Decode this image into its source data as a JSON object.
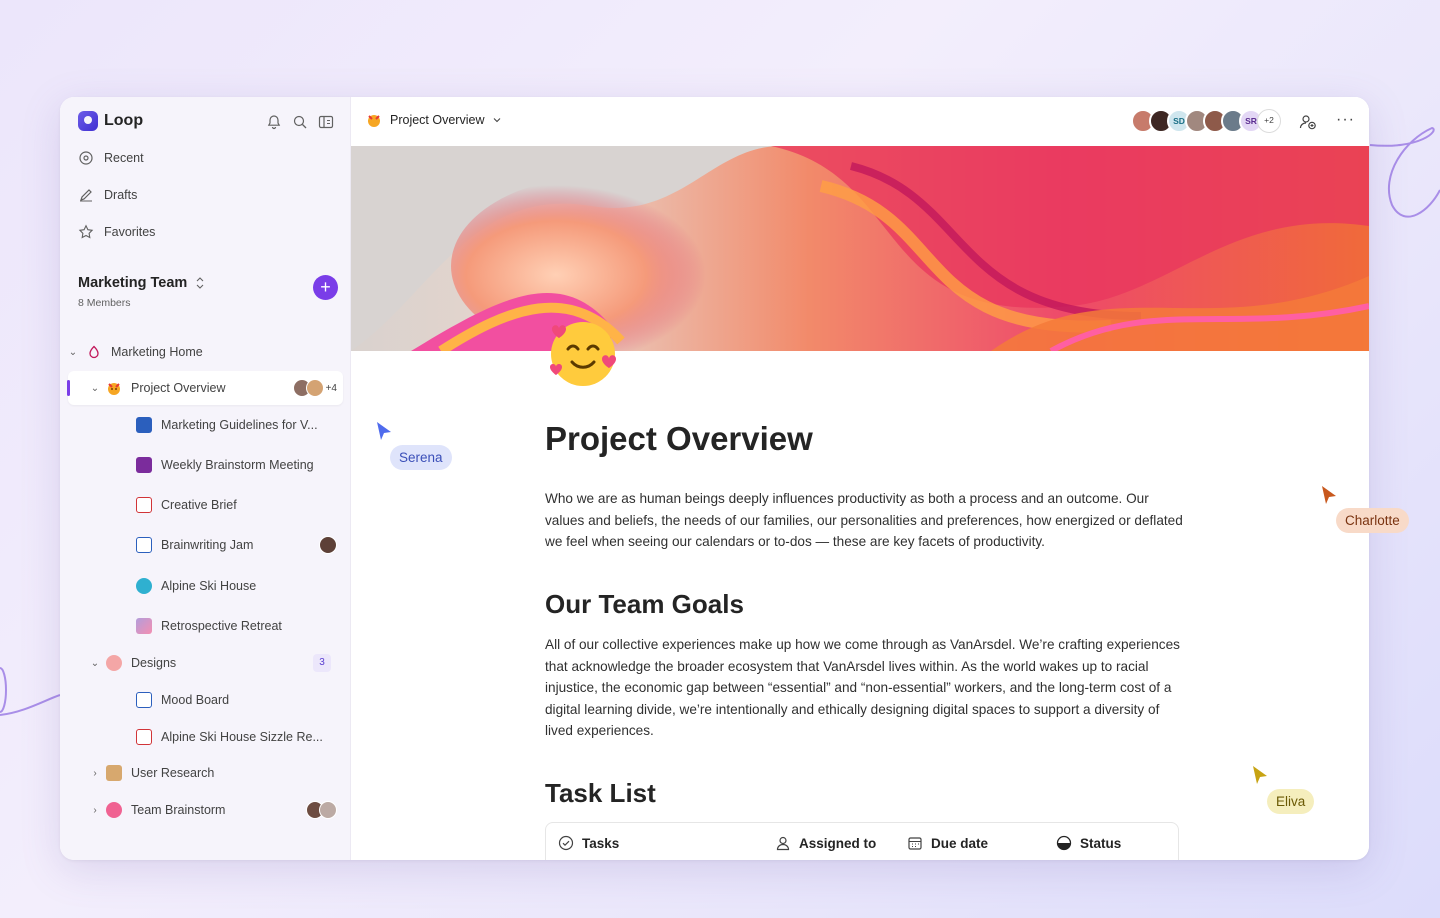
{
  "app": {
    "name": "Loop"
  },
  "sidebar": {
    "nav": [
      {
        "label": "Recent",
        "icon": "recent-icon"
      },
      {
        "label": "Drafts",
        "icon": "drafts-icon"
      },
      {
        "label": "Favorites",
        "icon": "star-icon"
      }
    ],
    "workspace": {
      "name": "Marketing Team",
      "members": "8 Members"
    },
    "tree": [
      {
        "label": "Marketing Home",
        "icon": "home-icon"
      },
      {
        "label": "Project Overview",
        "icon": "project-emoji-icon",
        "extra": "+4"
      },
      {
        "label": "Marketing Guidelines for V...",
        "icon": "word-doc-icon"
      },
      {
        "label": "Weekly Brainstorm Meeting",
        "icon": "onenote-icon"
      },
      {
        "label": "Creative Brief",
        "icon": "pdf-icon"
      },
      {
        "label": "Brainwriting Jam",
        "icon": "whiteboard-icon"
      },
      {
        "label": "Alpine Ski House",
        "icon": "ski-icon"
      },
      {
        "label": "Retrospective Retreat",
        "icon": "unicorn-icon"
      },
      {
        "label": "Designs",
        "icon": "palette-icon",
        "badge": "3"
      },
      {
        "label": "Mood Board",
        "icon": "whiteboard-icon"
      },
      {
        "label": "Alpine Ski House Sizzle Re...",
        "icon": "video-icon"
      },
      {
        "label": "User Research",
        "icon": "research-icon"
      },
      {
        "label": "Team Brainstorm",
        "icon": "brain-icon"
      }
    ]
  },
  "header": {
    "breadcrumb": "Project Overview",
    "avatars": [
      "",
      "",
      "SD",
      "",
      "",
      "",
      "SR"
    ],
    "more_count": "+2"
  },
  "document": {
    "title": "Project Overview",
    "intro": "Who we are as human beings deeply influences productivity as both a process and an outcome. Our values and beliefs, the needs of our families, our personalities and preferences, how energized or deflated we feel when seeing our calendars or to-dos — these are key facets of productivity.",
    "goals_heading": "Our Team Goals",
    "goals_text": "All of our collective experiences make up how we come through as VanArsdel. We’re crafting experiences that acknowledge the broader ecosystem that VanArsdel lives within. As the world wakes up to racial injustice, the economic gap between “essential” and “non-essential” workers, and the long-term cost of a digital learning divide, we’re intentionally and ethically designing digital spaces to support a diversity of lived experiences.",
    "tasks_heading": "Task List",
    "table_headers": [
      "Tasks",
      "Assigned to",
      "Due date",
      "Status"
    ]
  },
  "cursors": [
    {
      "name": "Serena",
      "color": "#4f6bed",
      "bg": "#dfe4fb"
    },
    {
      "name": "Charlotte",
      "color": "#c8581d",
      "bg": "#f8dac8"
    },
    {
      "name": "Eliva",
      "color": "#c7a313",
      "bg": "#f5eebd"
    }
  ],
  "colors": {
    "accent": "#7a3de8"
  }
}
